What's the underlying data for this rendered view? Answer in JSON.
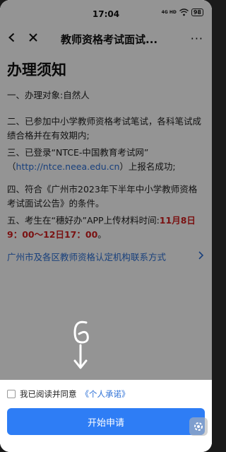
{
  "status_bar": {
    "time": "17:04",
    "network": "4G HD",
    "battery": "98"
  },
  "nav": {
    "title": "教师资格考试面试...",
    "more": "···"
  },
  "content": {
    "heading": "办理须知",
    "items": [
      "一、办理对象:自然人",
      "二、已参加中小学教师资格考试笔试，各科笔试成绩合格并在有效期内;",
      "三、已登录“NTCE-中国教育考试网”",
      "（",
      "http://ntce.neea.edu.cn",
      "）上报名成功;",
      "四、符合《广州市2023年下半年中小学教师资格考试面试公告》的条件。",
      "五、考生在“穗好办”APP上传材料时间:",
      "11月8日9：00～12日17：00",
      "。"
    ],
    "agency_link": "广州市及各区教师资格认定机构联系方式"
  },
  "bottom": {
    "agree_prefix": "我已阅读并同意",
    "agree_link": "《个人承诺》",
    "apply_button": "开始申请"
  },
  "colors": {
    "accent": "#2e7df5",
    "link": "#2b6fd6",
    "highlight": "#d32020"
  }
}
